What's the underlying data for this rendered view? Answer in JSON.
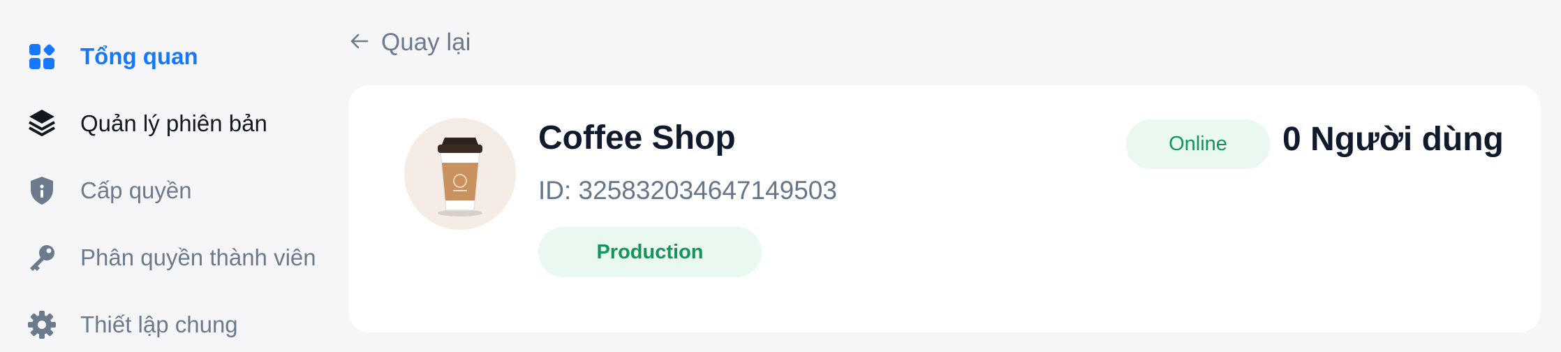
{
  "sidebar": {
    "items": [
      {
        "label": "Tổng quan",
        "icon": "dashboard-icon",
        "active": true
      },
      {
        "label": "Quản lý phiên bản",
        "icon": "layers-icon"
      },
      {
        "label": "Cấp quyền",
        "icon": "shield-icon"
      },
      {
        "label": "Phân quyền thành viên",
        "icon": "key-icon"
      },
      {
        "label": "Thiết lập chung",
        "icon": "gear-icon"
      }
    ]
  },
  "header": {
    "back_label": "Quay lại",
    "back_icon": "arrow-left-icon"
  },
  "app": {
    "name": "Coffee Shop",
    "id_text": "ID: 325832034647149503",
    "environment": "Production",
    "status": "Online",
    "user_count": "0 Người dùng",
    "logo_icon": "coffee-cup-icon"
  },
  "colors": {
    "accent": "#1677ff",
    "success_text": "#14945a",
    "success_bg": "#e9f9ef",
    "muted_text": "#6b7a8c",
    "heading_text": "#0f1b2d"
  }
}
